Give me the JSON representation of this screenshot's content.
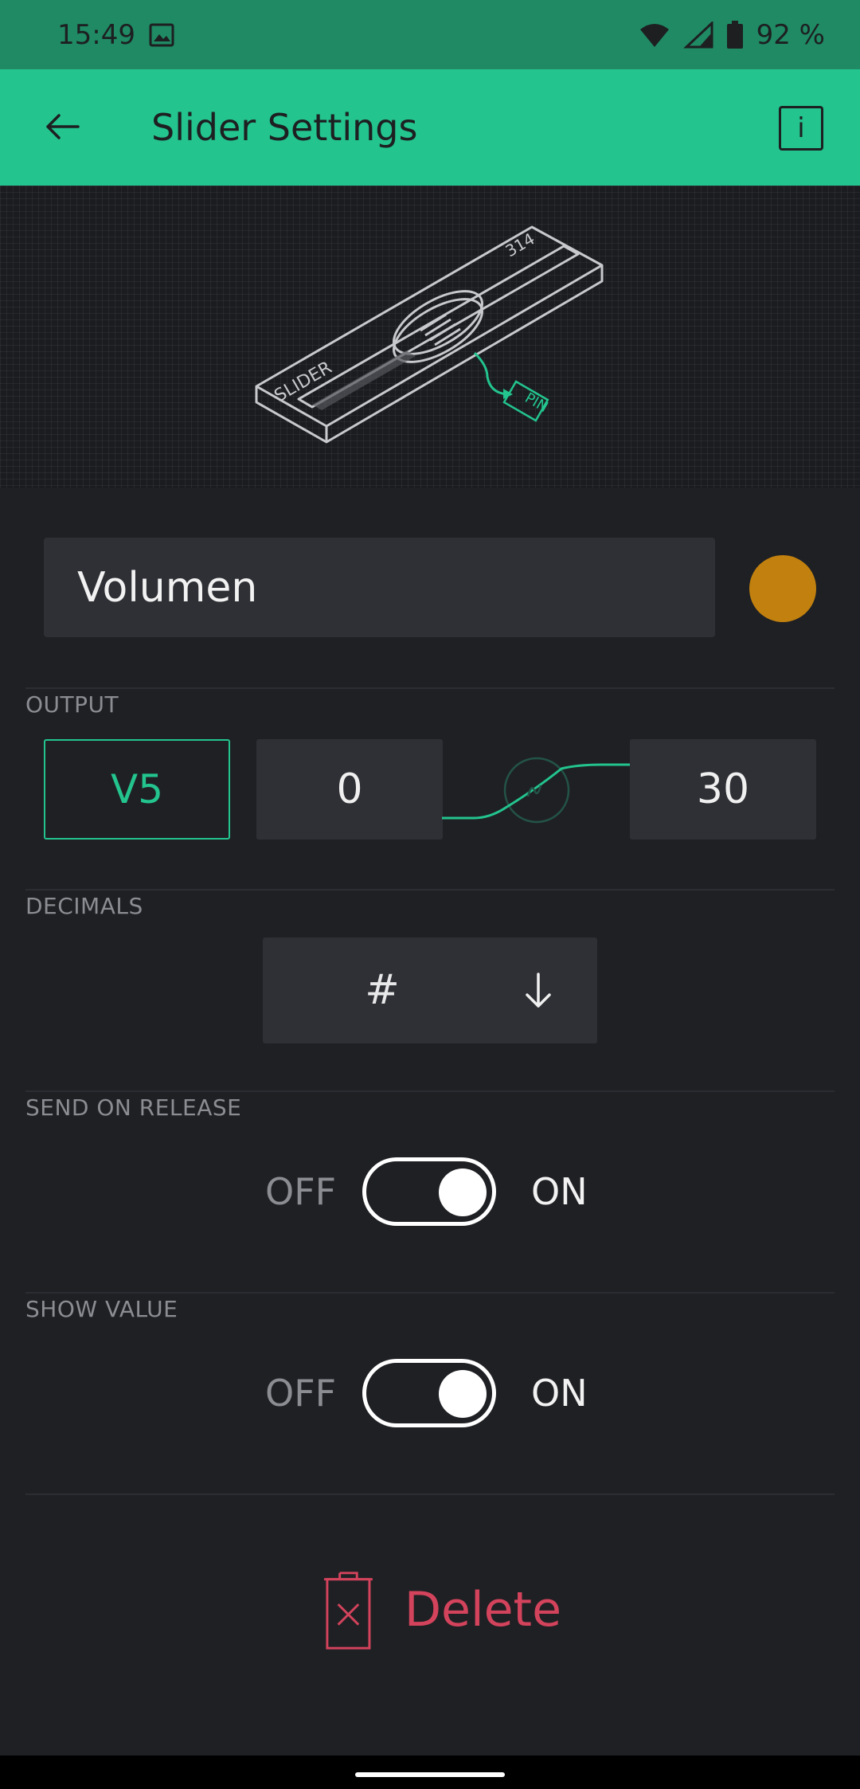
{
  "status_bar": {
    "time": "15:49",
    "battery": "92 %",
    "icons": [
      "image-icon",
      "wifi-icon",
      "signal-icon",
      "battery-icon"
    ]
  },
  "app_bar": {
    "title": "Slider Settings",
    "back_icon": "arrow-left-icon",
    "info_label": "i"
  },
  "illustration": {
    "slider_label": "SLIDER",
    "value_label": "314",
    "pin_label": "PIN"
  },
  "name_field": {
    "value": "Volumen"
  },
  "colors": {
    "accent": "#23c48e",
    "widget_color": "#c2810e",
    "delete": "#d3435c"
  },
  "output": {
    "section_label": "OUTPUT",
    "pin": "V5",
    "min": "0",
    "max": "30"
  },
  "decimals": {
    "section_label": "DECIMALS",
    "value": "#",
    "icon": "arrow-down-icon"
  },
  "send_on_release": {
    "section_label": "SEND ON RELEASE",
    "off_label": "OFF",
    "on_label": "ON",
    "state": "on"
  },
  "show_value": {
    "section_label": "SHOW VALUE",
    "off_label": "OFF",
    "on_label": "ON",
    "state": "on"
  },
  "delete": {
    "label": "Delete",
    "icon": "trash-icon"
  }
}
